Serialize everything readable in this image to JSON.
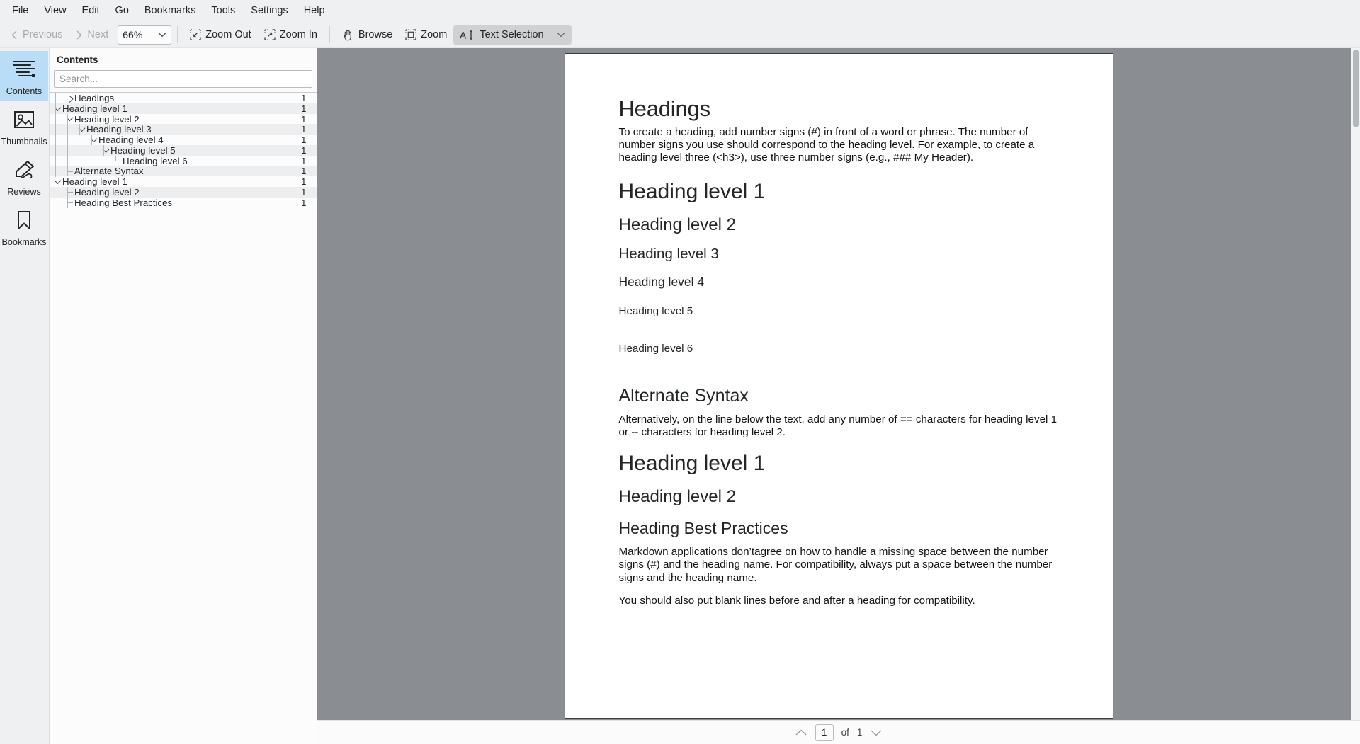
{
  "menubar": {
    "items": [
      {
        "label": "File"
      },
      {
        "label": "View"
      },
      {
        "label": "Edit"
      },
      {
        "label": "Go"
      },
      {
        "label": "Bookmarks"
      },
      {
        "label": "Tools"
      },
      {
        "label": "Settings"
      },
      {
        "label": "Help"
      }
    ]
  },
  "toolbar": {
    "previous_label": "Previous",
    "next_label": "Next",
    "zoom_value": "66%",
    "zoom_out_label": "Zoom Out",
    "zoom_in_label": "Zoom In",
    "browse_label": "Browse",
    "zoom_label": "Zoom",
    "text_selection_label": "Text Selection"
  },
  "rail": {
    "items": [
      {
        "label": "Contents",
        "icon": "contents-icon",
        "selected": true
      },
      {
        "label": "Thumbnails",
        "icon": "thumbnails-icon",
        "selected": false
      },
      {
        "label": "Reviews",
        "icon": "reviews-icon",
        "selected": false
      },
      {
        "label": "Bookmarks",
        "icon": "bookmarks-icon",
        "selected": false
      }
    ]
  },
  "panel": {
    "title": "Contents",
    "search_placeholder": "Search...",
    "search_value": "",
    "tree": [
      {
        "label": "Headings",
        "page": "1",
        "indent": 1,
        "toggle": "right",
        "alt": false
      },
      {
        "label": "Heading level 1",
        "page": "1",
        "indent": 0,
        "toggle": "down",
        "alt": true
      },
      {
        "label": "Heading level 2",
        "page": "1",
        "indent": 1,
        "toggle": "down",
        "alt": false
      },
      {
        "label": "Heading level 3",
        "page": "1",
        "indent": 2,
        "toggle": "down",
        "alt": true
      },
      {
        "label": "Heading level 4",
        "page": "1",
        "indent": 3,
        "toggle": "down",
        "alt": false
      },
      {
        "label": "Heading level 5",
        "page": "1",
        "indent": 4,
        "toggle": "down",
        "alt": true
      },
      {
        "label": "Heading level 6",
        "page": "1",
        "indent": 5,
        "toggle": "none",
        "alt": false
      },
      {
        "label": "Alternate Syntax",
        "page": "1",
        "indent": 1,
        "toggle": "none",
        "alt": true
      },
      {
        "label": "Heading level 1",
        "page": "1",
        "indent": 0,
        "toggle": "down",
        "alt": false
      },
      {
        "label": "Heading level 2",
        "page": "1",
        "indent": 1,
        "toggle": "none",
        "alt": true
      },
      {
        "label": "Heading Best Practices",
        "page": "1",
        "indent": 1,
        "toggle": "none",
        "alt": false
      }
    ]
  },
  "document": {
    "title": "Headings",
    "intro_paragraph": "To create a heading, add number signs (#) in front of a word or phrase. The number of number signs you use should correspond to the heading level. For example, to create a heading level three (<h3>), use three number signs (e.g., ### My Header).",
    "heading_level_1": "Heading level 1",
    "heading_level_2": "Heading level 2",
    "heading_level_3": "Heading level 3",
    "heading_level_4": "Heading level 4",
    "heading_level_5": "Heading level 5",
    "heading_level_6": "Heading level 6",
    "alternate_syntax_title": "Alternate Syntax",
    "alternate_syntax_paragraph": "Alternatively, on the line below the text, add any number of == characters for heading level 1 or -- characters for heading level 2.",
    "alt_heading_level_1": "Heading level 1",
    "alt_heading_level_2": "Heading level 2",
    "best_practices_title": "Heading Best Practices",
    "best_practices_paragraph_1": "Markdown applications don’tagree on how to handle a missing space between the number signs (#) and the heading name. For compatibility, always put a space between the number signs and the heading name.",
    "best_practices_paragraph_2": "You should also put blank lines before and after a heading for compatibility."
  },
  "statusbar": {
    "current_page": "1",
    "of_label": "of",
    "total_pages": "1"
  },
  "colors": {
    "chrome": "#eff0f1",
    "selection": "#b9dcf7",
    "page_bg": "#8a8e93",
    "active_tool": "#cfd1d3"
  }
}
